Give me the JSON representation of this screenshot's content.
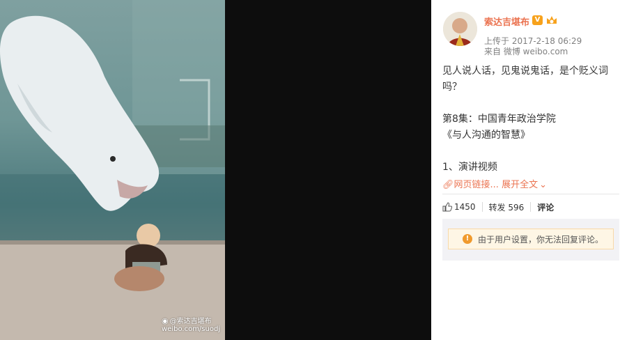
{
  "photo": {
    "watermark_name": "@索达吉堪布",
    "watermark_url": "weibo.com/suodj"
  },
  "post": {
    "author": "索达吉堪布",
    "verified_badge": "V",
    "upload_time": "上传于 2017-2-18 06:29",
    "source": "来自 微博 weibo.com",
    "line1": "见人说人话，见鬼说鬼话，是个贬义词",
    "line2": "吗？",
    "line3": "第8集：中国青年政治学院",
    "line4": "《与人沟通的智慧》",
    "line5": "1、演讲视频",
    "link_label": "网页链接...",
    "expand_label": "展开全文"
  },
  "actions": {
    "likes": "1450",
    "repost_label": "转发 596",
    "comment_label": "评论"
  },
  "comments": {
    "notice": "由于用户设置，你无法回复评论。"
  },
  "colors": {
    "accent": "#eb7350",
    "badge": "#f7a21c",
    "warn": "#f09a2d"
  }
}
